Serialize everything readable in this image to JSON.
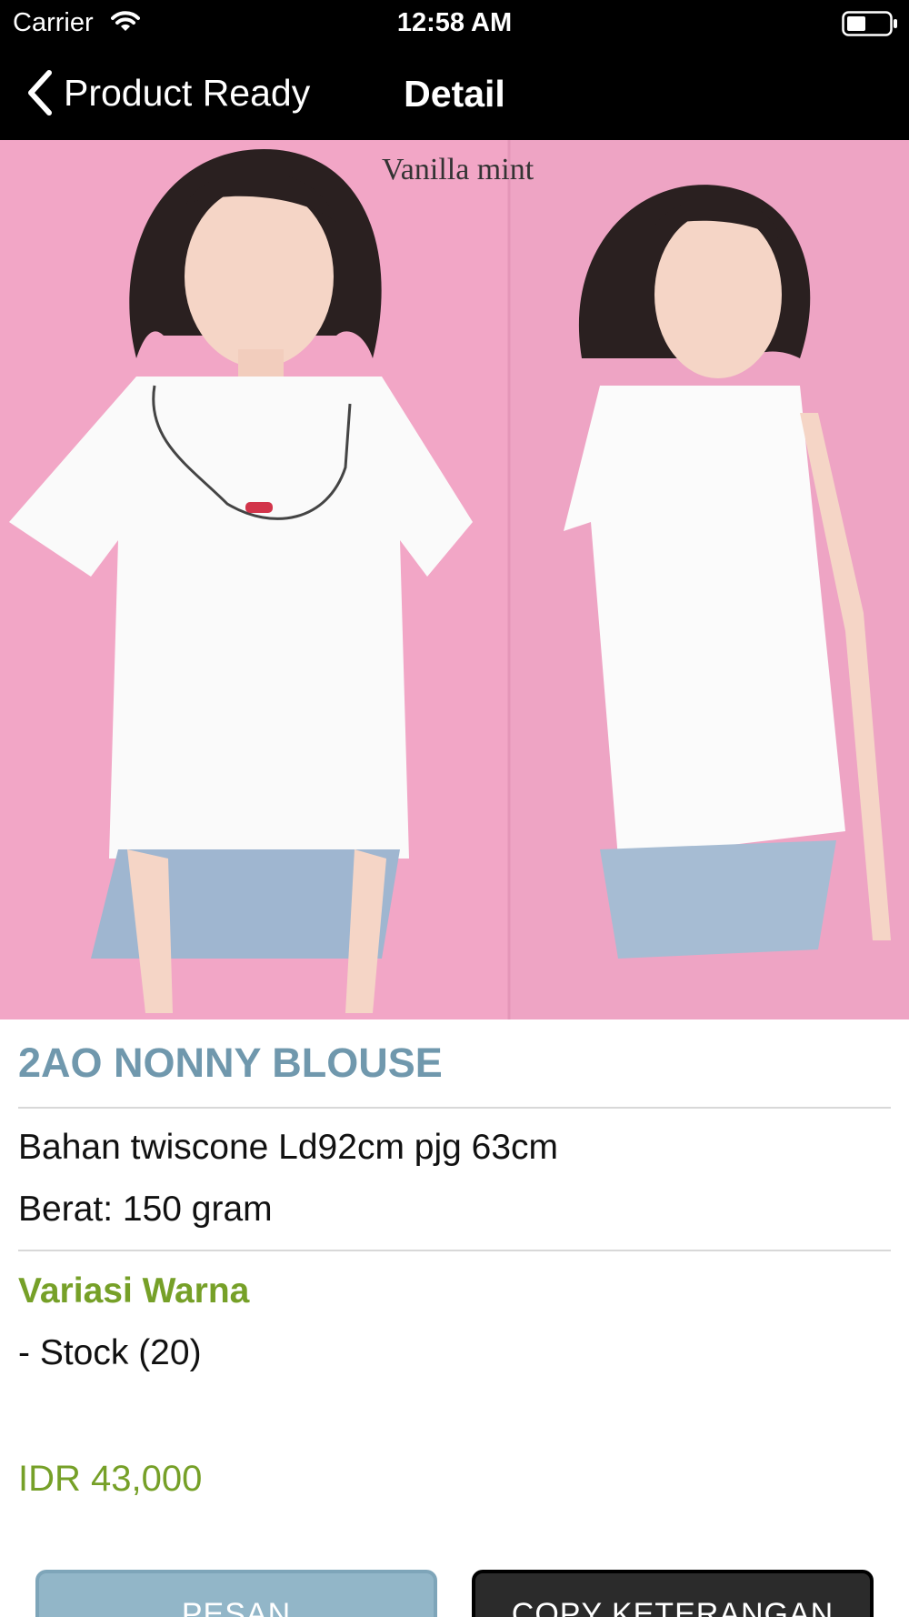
{
  "status_bar": {
    "carrier": "Carrier",
    "time": "12:58 AM"
  },
  "nav": {
    "back_label": "Product Ready",
    "title": "Detail"
  },
  "product": {
    "image_caption": "Vanilla mint",
    "name": "2AO NONNY BLOUSE",
    "description_lines": [
      "Bahan twiscone Ld92cm pjg 63cm",
      "Berat: 150 gram"
    ],
    "variant_title": "Variasi Warna",
    "stock_text": "- Stock  (20)",
    "price": "IDR 43,000"
  },
  "actions": {
    "order_label": "PESAN",
    "copy_label": "COPY KETERANGAN"
  },
  "colors": {
    "product_name": "#7098ad",
    "accent_green": "#76a028",
    "order_button": "#92b6c8",
    "copy_button": "#2b2b2b",
    "image_background": "#f0a9c8"
  },
  "icons": {
    "wifi": "wifi-icon",
    "battery": "battery-icon",
    "back": "chevron-left-icon"
  }
}
